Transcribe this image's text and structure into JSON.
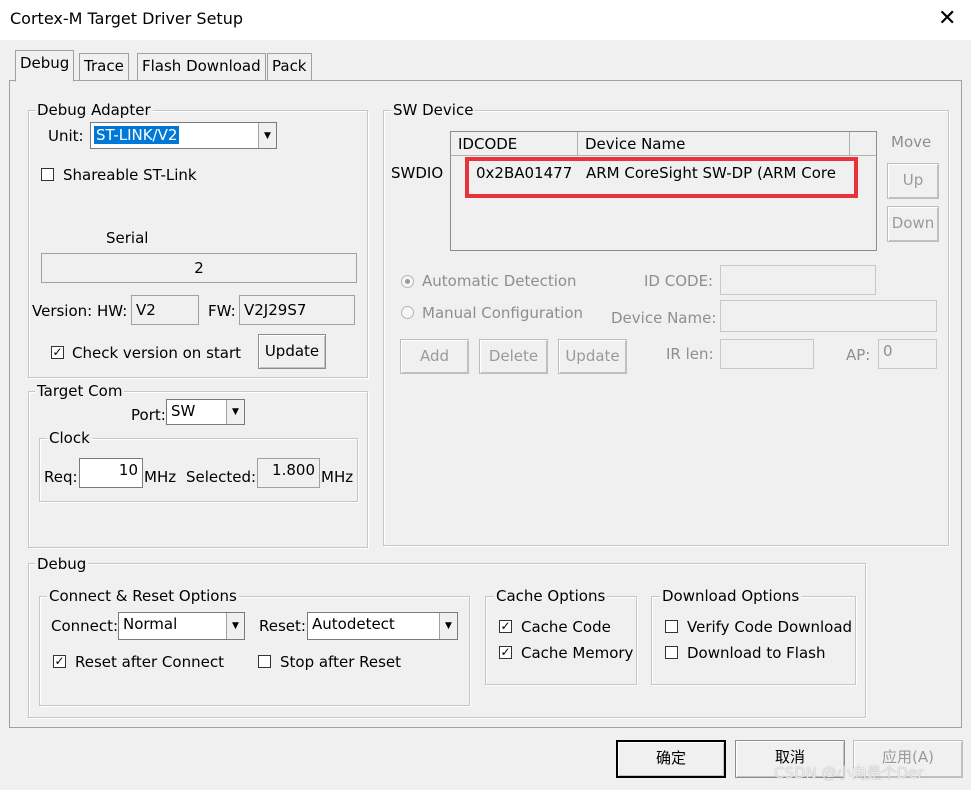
{
  "window": {
    "title": "Cortex-M Target Driver Setup",
    "close_glyph": "✕"
  },
  "tabs": [
    {
      "label": "Debug",
      "active": true
    },
    {
      "label": "Trace",
      "active": false
    },
    {
      "label": "Flash Download",
      "active": false
    },
    {
      "label": "Pack",
      "active": false
    }
  ],
  "debug_adapter": {
    "group_label": "Debug Adapter",
    "unit_label": "Unit:",
    "unit_value": "ST-LINK/V2",
    "shareable_label": "Shareable ST-Link",
    "shareable_checked": false,
    "serial_label": "Serial",
    "serial_value": "2",
    "version_label": "Version: HW:",
    "hw_value": "V2",
    "fw_label": "FW:",
    "fw_value": "V2J29S7",
    "check_version_label": "Check version on start",
    "check_version_checked": true,
    "update_button": "Update"
  },
  "target_com": {
    "group_label": "Target Com",
    "port_label": "Port:",
    "port_value": "SW",
    "clock": {
      "group_label": "Clock",
      "req_label": "Req:",
      "req_value": "10",
      "req_unit": "MHz",
      "selected_label": "Selected:",
      "selected_value": "1.800",
      "selected_unit": "MHz"
    }
  },
  "sw_device": {
    "group_label": "SW Device",
    "swdio_label": "SWDIO",
    "columns": [
      "IDCODE",
      "Device Name"
    ],
    "rows": [
      {
        "idcode": "0x2BA01477",
        "device_name": "ARM CoreSight SW-DP (ARM Core"
      }
    ],
    "move_label": "Move",
    "up_button": "Up",
    "down_button": "Down",
    "auto_detect_label": "Automatic Detection",
    "manual_config_label": "Manual Configuration",
    "id_code_label": "ID CODE:",
    "device_name_label": "Device Name:",
    "ir_len_label": "IR len:",
    "ap_label": "AP:",
    "ap_value": "0",
    "add_button": "Add",
    "delete_button": "Delete",
    "update_button": "Update",
    "highlight_color": "#e8333a"
  },
  "debug": {
    "group_label": "Debug",
    "connect_reset": {
      "group_label": "Connect & Reset Options",
      "connect_label": "Connect:",
      "connect_value": "Normal",
      "reset_label": "Reset:",
      "reset_value": "Autodetect",
      "reset_after_connect_label": "Reset after Connect",
      "reset_after_connect_checked": true,
      "stop_after_reset_label": "Stop after Reset",
      "stop_after_reset_checked": false
    },
    "cache": {
      "group_label": "Cache Options",
      "cache_code_label": "Cache Code",
      "cache_code_checked": true,
      "cache_memory_label": "Cache Memory",
      "cache_memory_checked": true
    },
    "download": {
      "group_label": "Download Options",
      "verify_label": "Verify Code Download",
      "verify_checked": false,
      "download_flash_label": "Download to Flash",
      "download_flash_checked": false
    }
  },
  "footer": {
    "ok_button": "确定",
    "cancel_button": "取消",
    "apply_button": "应用(A)",
    "watermark": "CSDN @小向是个Der"
  },
  "glyphs": {
    "check": "✓",
    "dropdown": "▼"
  }
}
